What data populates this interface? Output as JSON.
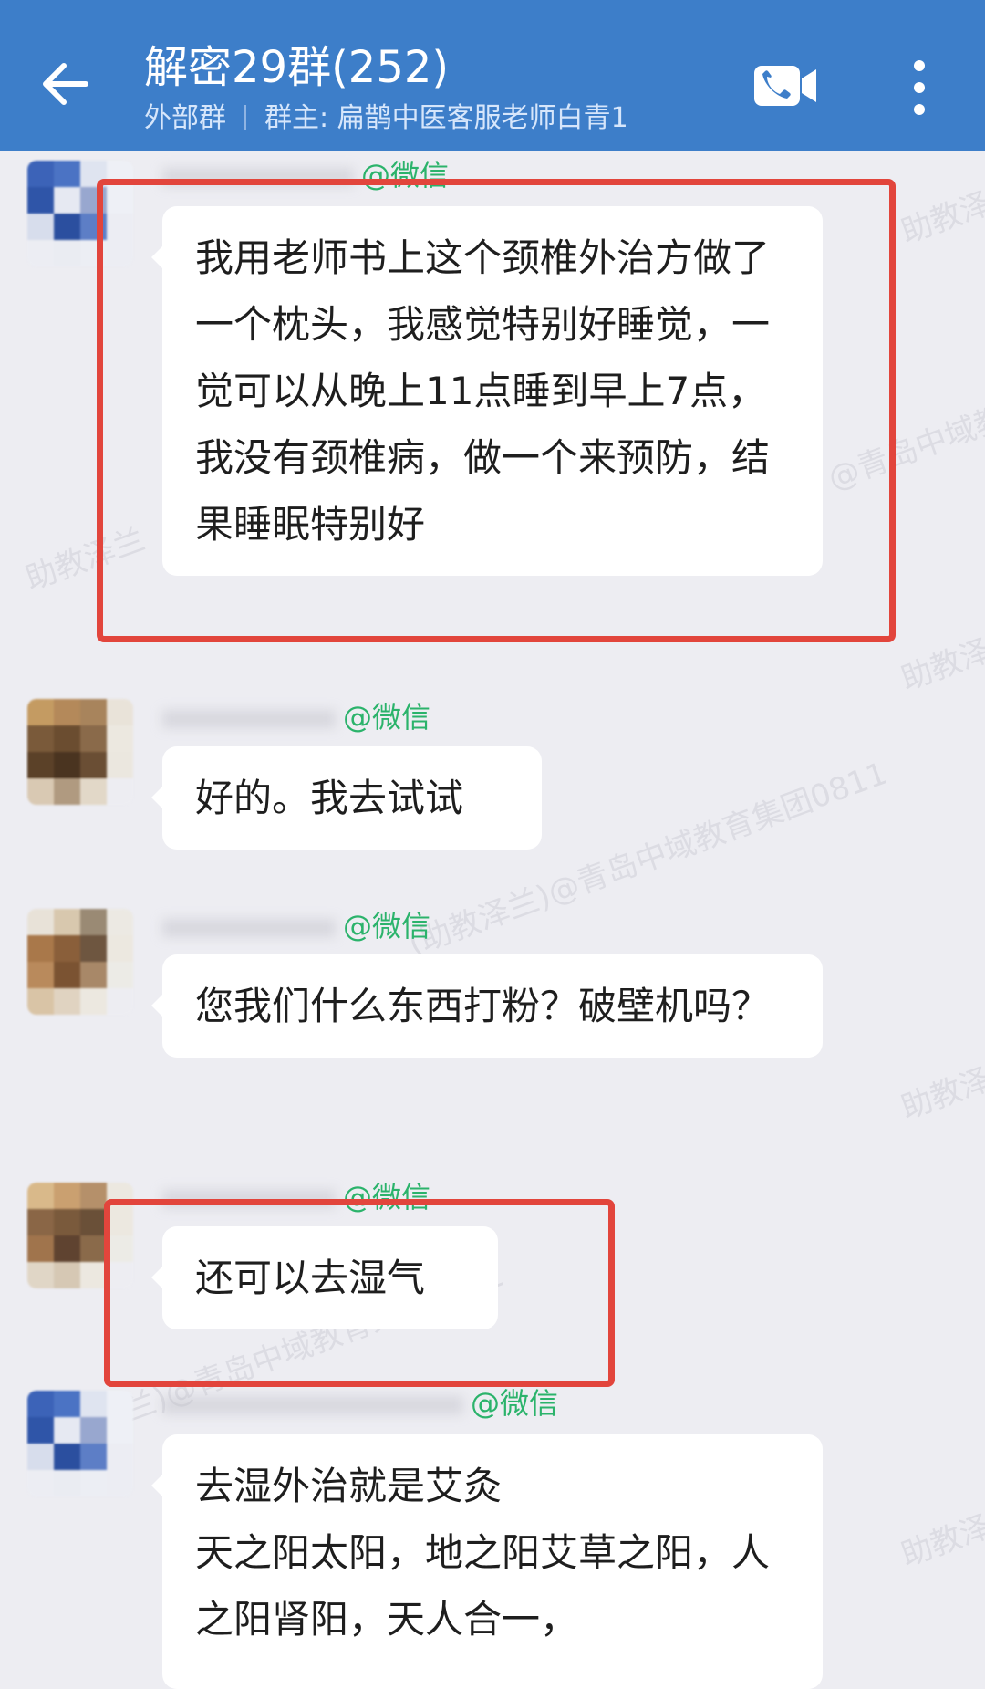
{
  "header": {
    "back_icon": "arrow-left-icon",
    "title": "解密29群(252)",
    "subtitle_type": "外部群",
    "subtitle_owner": "群主: 扁鹊中医客服老师白青1",
    "video_icon": "video-call-icon",
    "more_icon": "more-vertical-icon",
    "background_color": "#3d7ec9"
  },
  "messages": [
    {
      "sender_suffix": "@微信",
      "text": "我用老师书上这个颈椎外治方做了一个枕头，我感觉特别好睡觉，一觉可以从晚上11点睡到早上7点，我没有颈椎病，做一个来预防，结果睡眠特别好",
      "highlighted": true
    },
    {
      "sender_suffix": "@微信",
      "text": "好的。我去试试",
      "highlighted": false
    },
    {
      "sender_suffix": "@微信",
      "text": "您我们什么东西打粉？破壁机吗？",
      "highlighted": false
    },
    {
      "sender_suffix": "@微信",
      "text": "还可以去湿气",
      "highlighted": true
    },
    {
      "sender_suffix": "@微信",
      "text": "去湿外治就是艾灸\n天之阳太阳，地之阳艾草之阳，人之阳肾阳，天人合一，",
      "highlighted": false
    }
  ],
  "watermark": {
    "text_1": "助教泽兰",
    "text_2": "@青岛中域教育集团0811",
    "text_3": "(助教泽兰)@青岛中域教育集团0811"
  },
  "colors": {
    "highlight": "#e2453c",
    "wechat_green": "#2bb36b",
    "chat_background": "#ededf2"
  }
}
